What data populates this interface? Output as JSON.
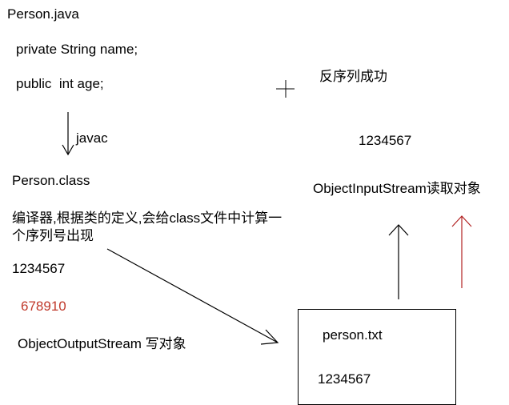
{
  "source": {
    "file": "Person.java",
    "field_private": "private String name;",
    "field_public": "public  int age;"
  },
  "compile": {
    "label": "javac"
  },
  "compiled": {
    "file": "Person.class",
    "note": "编译器,根据类的定义,会给class文件中计算一个序列号出现",
    "serial": "1234567",
    "changed_serial": "678910",
    "writer": "ObjectOutputStream 写对象"
  },
  "storage": {
    "file": "person.txt",
    "serial": "1234567"
  },
  "reader": {
    "success": "反序列成功",
    "serial": "1234567",
    "label": "ObjectInputStream读取对象"
  },
  "colors": {
    "text": "#000000",
    "changed": "#c0392b",
    "red_arrow": "#b22222"
  }
}
